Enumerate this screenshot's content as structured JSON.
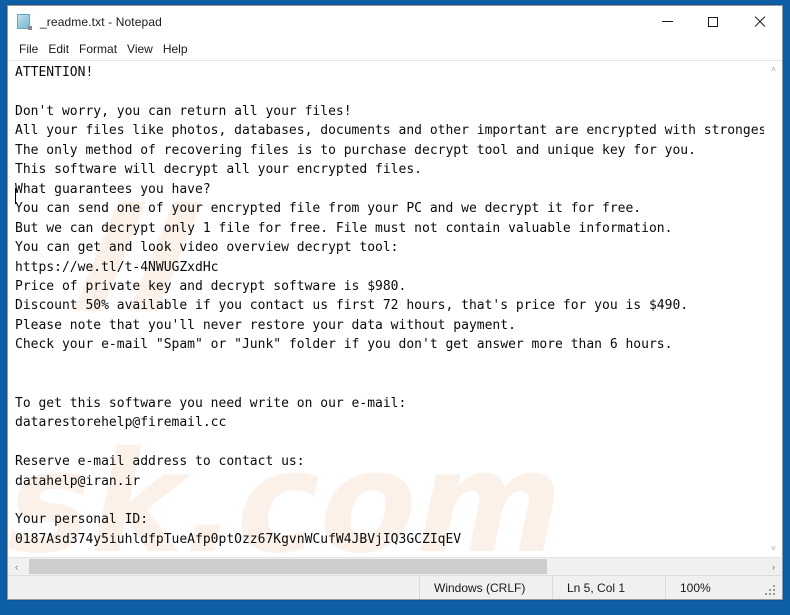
{
  "window": {
    "title": "_readme.txt - Notepad",
    "icon": "notepad-document-icon",
    "controls": {
      "minimize_label": "Minimize",
      "maximize_label": "Maximize",
      "close_label": "Close"
    }
  },
  "menu": {
    "items": [
      {
        "label": "File"
      },
      {
        "label": "Edit"
      },
      {
        "label": "Format"
      },
      {
        "label": "View"
      },
      {
        "label": "Help"
      }
    ]
  },
  "editor": {
    "watermark_text": "sk.com",
    "content": "ATTENTION!\n\nDon't worry, you can return all your files!\nAll your files like photos, databases, documents and other important are encrypted with strongest encryption and unique key.\nThe only method of recovering files is to purchase decrypt tool and unique key for you.\nThis software will decrypt all your encrypted files.\nWhat guarantees you have?\nYou can send one of your encrypted file from your PC and we decrypt it for free.\nBut we can decrypt only 1 file for free. File must not contain valuable information.\nYou can get and look video overview decrypt tool:\nhttps://we.tl/t-4NWUGZxdHc\nPrice of private key and decrypt software is $980.\nDiscount 50% available if you contact us first 72 hours, that's price for you is $490.\nPlease note that you'll never restore your data without payment.\nCheck your e-mail \"Spam\" or \"Junk\" folder if you don't get answer more than 6 hours.\n\n\nTo get this software you need write on our e-mail:\ndatarestorehelp@firemail.cc\n\nReserve e-mail address to contact us:\ndatahelp@iran.ir\n\nYour personal ID:\n0187Asd374y5iuhldfpTueAfp0ptOzz67KgvnWCufW4JBVjIQ3GCZIqEV",
    "ransom": {
      "price_full": "$980",
      "price_discount": "$490",
      "discount_percent": "50%",
      "discount_window_hours": "72 hours",
      "response_time": "6 hours",
      "free_decrypt_files": "1",
      "video_url": "https://we.tl/t-4NWUGZxdHc",
      "primary_email": "datarestorehelp@firemail.cc",
      "reserve_email": "datahelp@iran.ir",
      "personal_id": "0187Asd374y5iuhldfpTueAfp0ptOzz67KgvnWCufW4JBVjIQ3GCZIqEV"
    }
  },
  "scrollbars": {
    "vertical": {
      "up_arrow": "˄",
      "down_arrow": "˅"
    },
    "horizontal": {
      "left_arrow": "‹",
      "right_arrow": "›",
      "thumb_percent": "70"
    }
  },
  "status_bar": {
    "line_ending": "Windows (CRLF)",
    "cursor_position": "Ln 5, Col 1",
    "zoom": "100%"
  },
  "colors": {
    "desktop": "#0e5ea6",
    "window_bg": "#ffffff",
    "status_bg": "#f0f0f0",
    "text": "#0a0a0a",
    "watermark": "#fbf0e8"
  }
}
